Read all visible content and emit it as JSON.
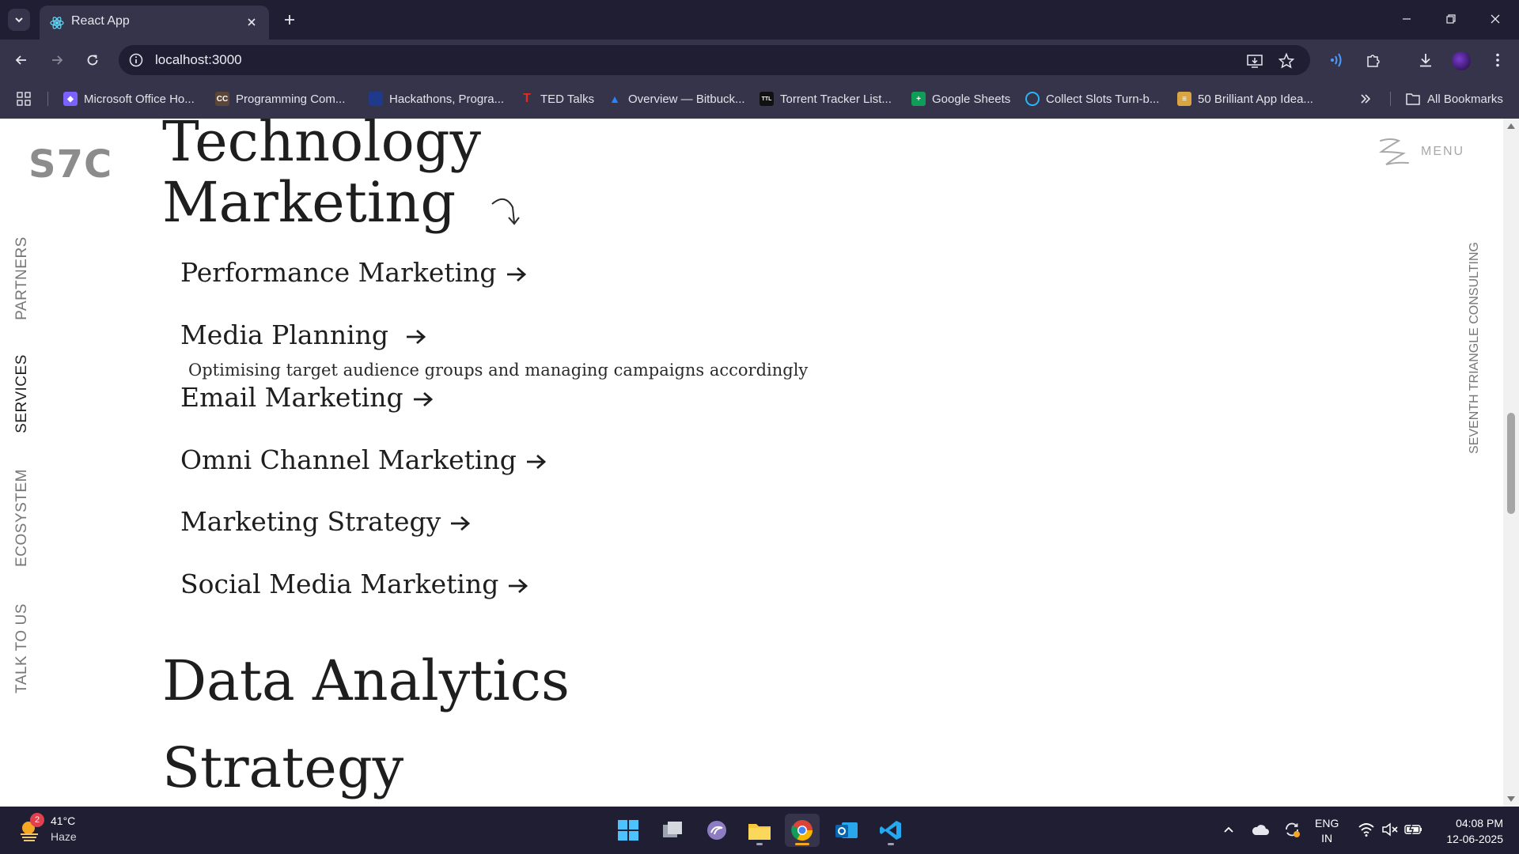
{
  "browser": {
    "tab_title": "React App",
    "url": "localhost:3000",
    "bookmarks": [
      {
        "label": "Microsoft Office Ho...",
        "icon": "office-icon",
        "color": "#7b61ff"
      },
      {
        "label": "Programming Com...",
        "icon": "codechef-icon",
        "color": "#5b4638"
      },
      {
        "label": "Hackathons, Progra...",
        "icon": "devpost-icon",
        "color": "#1f3a8a"
      },
      {
        "label": "TED Talks",
        "icon": "ted-icon",
        "color": "#e62b1e"
      },
      {
        "label": "Overview — Bitbuck...",
        "icon": "bitbucket-icon",
        "color": "#2684ff"
      },
      {
        "label": "Torrent Tracker List...",
        "icon": "torrent-icon",
        "color": "#111111"
      },
      {
        "label": "Google Sheets",
        "icon": "sheets-icon",
        "color": "#0f9d58"
      },
      {
        "label": "Collect Slots Turn-b...",
        "icon": "circle-icon",
        "color": "#29b6f6"
      },
      {
        "label": "50 Brilliant App Idea...",
        "icon": "article-icon",
        "color": "#d9a441"
      }
    ],
    "all_bookmarks": "All Bookmarks"
  },
  "page": {
    "logo": "S7C",
    "menu_label": "MENU",
    "side_nav": [
      "PARTNERS",
      "SERVICES",
      "ECOSYSTEM",
      "TALK TO US"
    ],
    "active_nav": "SERVICES",
    "right_label": "SEVENTH TRIANGLE CONSULTING",
    "top_cut_heading": "Technology",
    "marketing_heading": "Marketing",
    "marketing_items": [
      "Performance Marketing",
      "Media Planning",
      "Email Marketing",
      "Omni Channel Marketing",
      "Marketing Strategy",
      "Social Media Marketing"
    ],
    "media_planning_desc": "Optimising target audience groups and managing campaigns accordingly",
    "data_analytics_heading": "Data Analytics",
    "strategy_heading": "Strategy"
  },
  "taskbar": {
    "weather_temp": "41°C",
    "weather_cond": "Haze",
    "weather_badge": "2",
    "lang_line1": "ENG",
    "lang_line2": "IN",
    "time": "04:08 PM",
    "date": "12-06-2025"
  }
}
